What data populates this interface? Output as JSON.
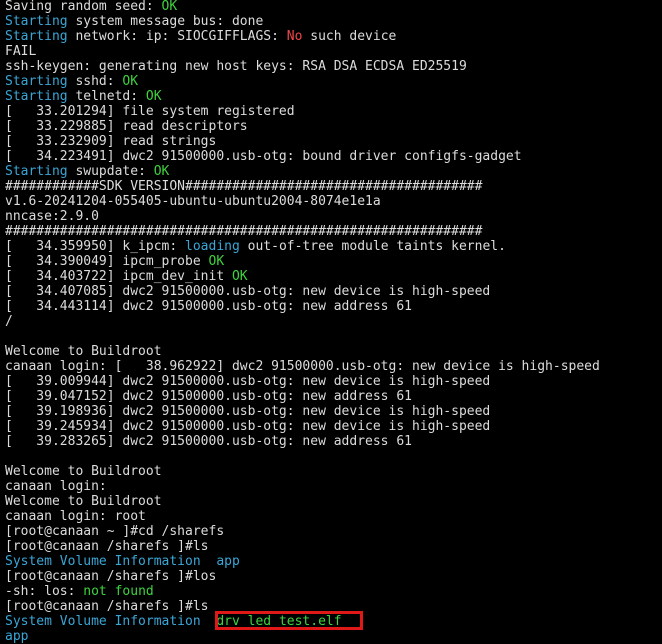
{
  "colors": {
    "background": "#000000",
    "default": "#dcdcdc",
    "cyan": "#3aa6d6",
    "green": "#3fd33f",
    "red": "#f04848",
    "highlight_box": "#e01818"
  },
  "lines": [
    [
      {
        "t": "Saving random seed: ",
        "c": "default"
      },
      {
        "t": "OK",
        "c": "green"
      }
    ],
    [
      {
        "t": "Starting",
        "c": "cyan"
      },
      {
        "t": " system message bus: done",
        "c": "default"
      }
    ],
    [
      {
        "t": "Starting",
        "c": "cyan"
      },
      {
        "t": " network: ip: SIOCGIFFLAGS: ",
        "c": "default"
      },
      {
        "t": "No",
        "c": "red"
      },
      {
        "t": " such device",
        "c": "default"
      }
    ],
    [
      {
        "t": "FAIL",
        "c": "default"
      }
    ],
    [
      {
        "t": "ssh-keygen: generating new host keys: RSA DSA ECDSA ED25519",
        "c": "default"
      }
    ],
    [
      {
        "t": "Starting",
        "c": "cyan"
      },
      {
        "t": " sshd: ",
        "c": "default"
      },
      {
        "t": "OK",
        "c": "green"
      }
    ],
    [
      {
        "t": "Starting",
        "c": "cyan"
      },
      {
        "t": " telnetd: ",
        "c": "default"
      },
      {
        "t": "OK",
        "c": "green"
      }
    ],
    [
      {
        "t": "[   33.201294] file system registered",
        "c": "default"
      }
    ],
    [
      {
        "t": "[   33.229885] read descriptors",
        "c": "default"
      }
    ],
    [
      {
        "t": "[   33.232909] read strings",
        "c": "default"
      }
    ],
    [
      {
        "t": "[   34.223491] dwc2 91500000.usb-otg: bound driver configfs-gadget",
        "c": "default"
      }
    ],
    [
      {
        "t": "Starting",
        "c": "cyan"
      },
      {
        "t": " swupdate: ",
        "c": "default"
      },
      {
        "t": "OK",
        "c": "green"
      }
    ],
    [
      {
        "t": "############SDK VERSION######################################",
        "c": "default"
      }
    ],
    [
      {
        "t": "v1.6-20241204-055405-ubuntu-ubuntu2004-8074e1e1a",
        "c": "default"
      }
    ],
    [
      {
        "t": "nncase:2.9.0",
        "c": "default"
      }
    ],
    [
      {
        "t": "#############################################################",
        "c": "default"
      }
    ],
    [
      {
        "t": "[   34.359950] k_ipcm: ",
        "c": "default"
      },
      {
        "t": "loading",
        "c": "cyan"
      },
      {
        "t": " out-of-tree module taints kernel.",
        "c": "default"
      }
    ],
    [
      {
        "t": "[   34.390049] ipcm_probe ",
        "c": "default"
      },
      {
        "t": "OK",
        "c": "green"
      }
    ],
    [
      {
        "t": "[   34.403722] ipcm_dev_init ",
        "c": "default"
      },
      {
        "t": "OK",
        "c": "green"
      }
    ],
    [
      {
        "t": "[   34.407085] dwc2 91500000.usb-otg: new device is high-speed",
        "c": "default"
      }
    ],
    [
      {
        "t": "[   34.443114] dwc2 91500000.usb-otg: new address 61",
        "c": "default"
      }
    ],
    [
      {
        "t": "/",
        "c": "default"
      }
    ],
    [
      {
        "t": " ",
        "c": "default"
      }
    ],
    [
      {
        "t": "Welcome to Buildroot",
        "c": "default"
      }
    ],
    [
      {
        "t": "canaan login: [   38.962922] dwc2 91500000.usb-otg: new device is high-speed",
        "c": "default"
      }
    ],
    [
      {
        "t": "[   39.009944] dwc2 91500000.usb-otg: new device is high-speed",
        "c": "default"
      }
    ],
    [
      {
        "t": "[   39.047152] dwc2 91500000.usb-otg: new address 61",
        "c": "default"
      }
    ],
    [
      {
        "t": "[   39.198936] dwc2 91500000.usb-otg: new device is high-speed",
        "c": "default"
      }
    ],
    [
      {
        "t": "[   39.245934] dwc2 91500000.usb-otg: new device is high-speed",
        "c": "default"
      }
    ],
    [
      {
        "t": "[   39.283265] dwc2 91500000.usb-otg: new address 61",
        "c": "default"
      }
    ],
    [
      {
        "t": " ",
        "c": "default"
      }
    ],
    [
      {
        "t": "Welcome to Buildroot",
        "c": "default"
      }
    ],
    [
      {
        "t": "canaan login:",
        "c": "default"
      }
    ],
    [
      {
        "t": "Welcome to Buildroot",
        "c": "default"
      }
    ],
    [
      {
        "t": "canaan login: root",
        "c": "default"
      }
    ],
    [
      {
        "t": "[root@canaan ~ ]#cd /sharefs",
        "c": "default"
      }
    ],
    [
      {
        "t": "[root@canaan /sharefs ]#ls",
        "c": "default"
      }
    ],
    [
      {
        "t": "System Volume Information  app",
        "c": "cyan"
      }
    ],
    [
      {
        "t": "[root@canaan /sharefs ]#los",
        "c": "default"
      }
    ],
    [
      {
        "t": "-sh: los: ",
        "c": "default"
      },
      {
        "t": "not found",
        "c": "green"
      }
    ],
    [
      {
        "t": "[root@canaan /sharefs ]#ls",
        "c": "default"
      }
    ],
    [
      {
        "t": "System Volume Information",
        "c": "cyan"
      },
      {
        "t": "  ",
        "c": "default"
      },
      {
        "t": "drv_led_test.elf",
        "c": "green"
      }
    ],
    [
      {
        "t": "app",
        "c": "cyan"
      }
    ]
  ]
}
